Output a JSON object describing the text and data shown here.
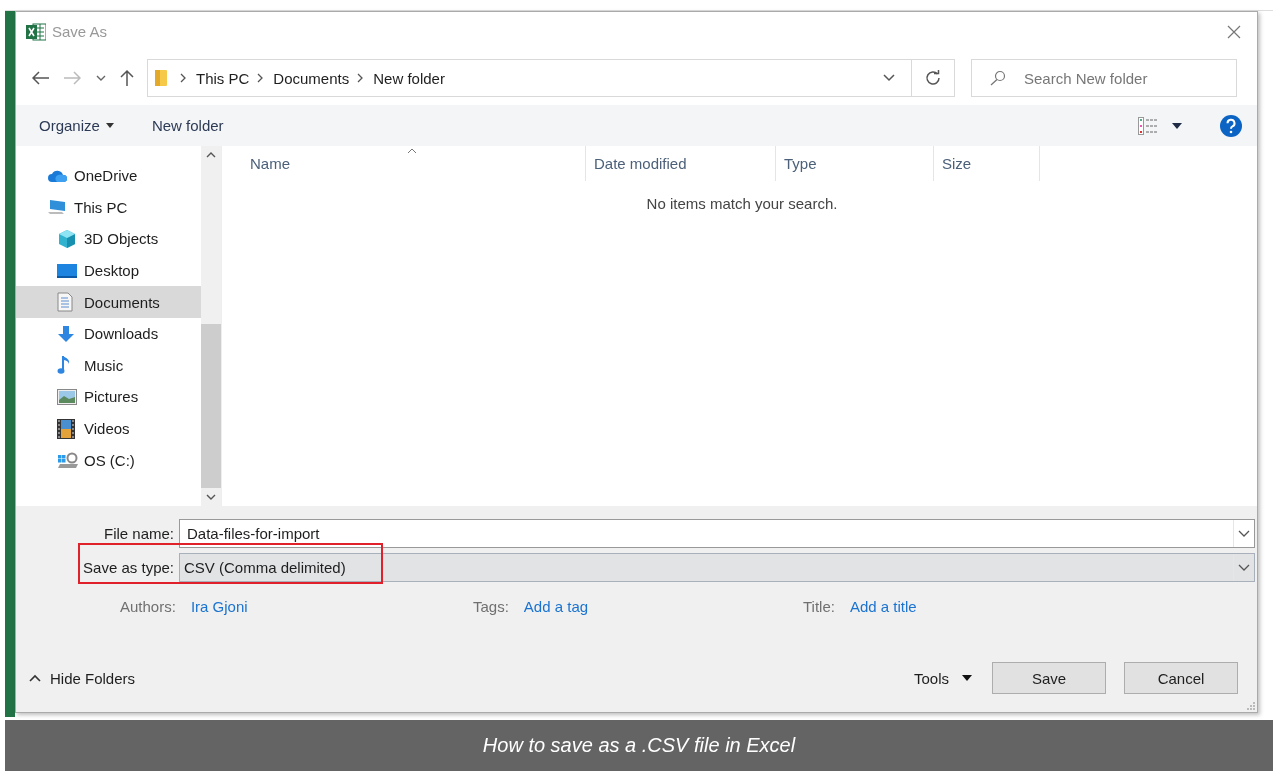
{
  "window": {
    "title": "Save As"
  },
  "address": {
    "breadcrumb": [
      "This PC",
      "Documents",
      "New folder"
    ]
  },
  "search": {
    "placeholder": "Search New folder"
  },
  "toolbar": {
    "organize": "Organize",
    "new_folder": "New folder"
  },
  "sidebar": {
    "items": [
      {
        "label": "OneDrive",
        "kind": "cloud",
        "selected": false
      },
      {
        "label": "This PC",
        "kind": "pc",
        "selected": false,
        "children": [
          {
            "label": "3D Objects",
            "kind": "cube",
            "selected": false
          },
          {
            "label": "Desktop",
            "kind": "desktop",
            "selected": false
          },
          {
            "label": "Documents",
            "kind": "doc",
            "selected": true
          },
          {
            "label": "Downloads",
            "kind": "download",
            "selected": false
          },
          {
            "label": "Music",
            "kind": "music",
            "selected": false
          },
          {
            "label": "Pictures",
            "kind": "pictures",
            "selected": false
          },
          {
            "label": "Videos",
            "kind": "videos",
            "selected": false
          },
          {
            "label": "OS (C:)",
            "kind": "drive",
            "selected": false
          }
        ]
      }
    ]
  },
  "file_list": {
    "columns": [
      {
        "label": "Name",
        "sorted": true
      },
      {
        "label": "Date modified",
        "sorted": false
      },
      {
        "label": "Type",
        "sorted": false
      },
      {
        "label": "Size",
        "sorted": false
      }
    ],
    "empty_message": "No items match your search."
  },
  "form": {
    "file_name": {
      "label": "File name:",
      "value": "Data-files-for-import"
    },
    "save_as_type": {
      "label": "Save as type:",
      "value": "CSV (Comma delimited)",
      "highlighted": true
    },
    "meta": [
      {
        "label": "Authors:",
        "value": "Ira Gjoni"
      },
      {
        "label": "Tags:",
        "value": "Add a tag"
      },
      {
        "label": "Title:",
        "value": "Add a title"
      }
    ]
  },
  "footer": {
    "hide_folders": "Hide Folders",
    "tools": "Tools",
    "buttons": [
      "Save",
      "Cancel"
    ]
  },
  "caption": "How to save as a .CSV file in Excel"
}
